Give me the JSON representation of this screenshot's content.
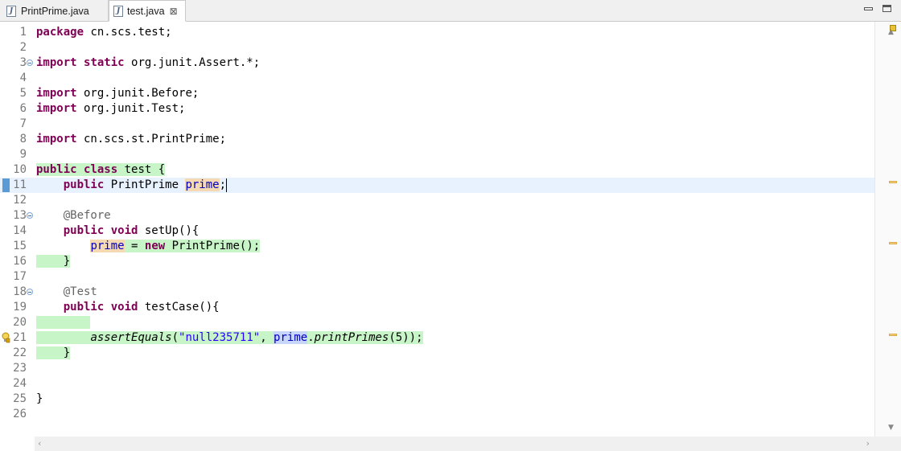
{
  "tabs": [
    {
      "label": "PrintPrime.java",
      "active": false
    },
    {
      "label": "test.java",
      "active": true
    }
  ],
  "tab_close_glyph": "⊠",
  "line_numbers": [
    "1",
    "2",
    "3",
    "4",
    "5",
    "6",
    "7",
    "8",
    "9",
    "10",
    "11",
    "12",
    "13",
    "14",
    "15",
    "16",
    "17",
    "18",
    "19",
    "20",
    "21",
    "22",
    "23",
    "24",
    "25",
    "26"
  ],
  "code": {
    "l1": {
      "kw": "package",
      "rest": " cn.scs.test;"
    },
    "l3": {
      "kw1": "import",
      "kw2": "static",
      "rest": " org.junit.Assert.*;"
    },
    "l5": {
      "kw": "import",
      "rest": " org.junit.Before;"
    },
    "l6": {
      "kw": "import",
      "rest": " org.junit.Test;"
    },
    "l8": {
      "kw": "import",
      "rest": " cn.scs.st.PrintPrime;"
    },
    "l10": {
      "kw1": "public",
      "kw2": "class",
      "rest": " test {"
    },
    "l11": {
      "indent": "    ",
      "kw": "public",
      "type": " PrintPrime ",
      "field": "prime",
      "end": ";"
    },
    "l13": {
      "indent": "    ",
      "ann": "@Before"
    },
    "l14": {
      "indent": "    ",
      "kw1": "public",
      "kw2": "void",
      "rest": " setUp(){"
    },
    "l15": {
      "indent": "        ",
      "field": "prime",
      "mid": " = ",
      "kw": "new",
      "rest": " PrintPrime();"
    },
    "l16": {
      "indent": "    ",
      "rest": "}"
    },
    "l18": {
      "indent": "    ",
      "ann": "@Test"
    },
    "l19": {
      "indent": "    ",
      "kw1": "public",
      "kw2": "void",
      "rest": " testCase(){"
    },
    "l21": {
      "indent": "        ",
      "method": "assertEquals",
      "open": "(",
      "str": "\"null235711\"",
      "comma": ", ",
      "field": "prime",
      "dot": ".",
      "call": "printPrimes",
      "args": "(5));"
    },
    "l22": {
      "indent": "    ",
      "rest": "}"
    },
    "l25": {
      "rest": "}"
    }
  },
  "colors": {
    "keyword": "#7f0055",
    "annotation": "#646464",
    "string": "#2a00ff",
    "field": "#0000c0",
    "coverage": "#c8f5c8",
    "current_line": "#e8f2fe"
  },
  "icons": [
    "java-file-icon",
    "close-icon",
    "minimize-icon",
    "maximize-icon",
    "fold-icon",
    "bookmark-icon",
    "quickfix-bulb-icon",
    "warning-icon"
  ]
}
